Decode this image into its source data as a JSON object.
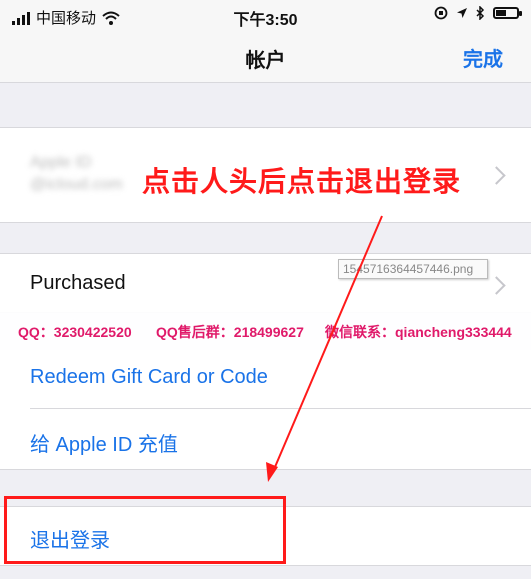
{
  "status_bar": {
    "carrier": "中国移动",
    "time": "下午3:50",
    "battery_level": 0.55,
    "icons": [
      "signal-icon",
      "wifi-icon",
      "orientation-lock-icon",
      "location-icon",
      "bluetooth-icon",
      "battery-icon"
    ]
  },
  "nav": {
    "title": "帐户",
    "done_label": "完成"
  },
  "account": {
    "blurred_lines": [
      "Apple ID",
      "@icloud.com"
    ]
  },
  "instruction": "点击人头后点击退出登录",
  "watermark": {
    "filename": "1545716364457446.png",
    "qq": "QQ：3230422520",
    "qq_group": "QQ售后群：218499627",
    "wechat": "微信联系：qiancheng333444"
  },
  "rows": {
    "purchased": "Purchased",
    "redeem": "Redeem Gift Card or Code",
    "topup": "给 Apple ID 充值",
    "signout": "退出登录"
  },
  "colors": {
    "accent_blue": "#1a73e8",
    "annotation_red": "#ff1a1a",
    "banner_pink": "#e01a6a",
    "background": "#efeff4"
  }
}
